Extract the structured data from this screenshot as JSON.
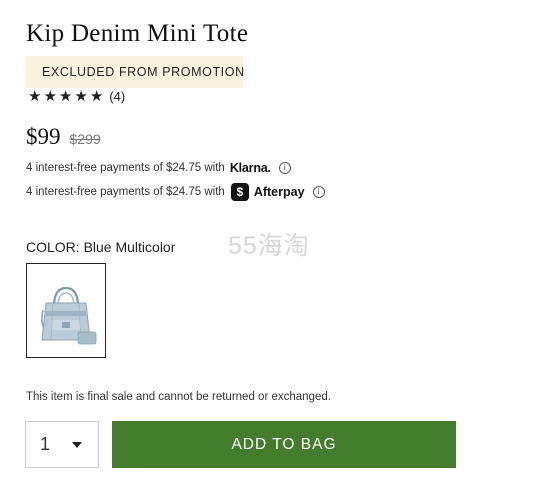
{
  "product": {
    "title": "Kip Denim Mini Tote",
    "promo_badge": "EXCLUDED FROM PROMOTION",
    "rating": {
      "stars": 5,
      "count_text": "(4)"
    },
    "price": {
      "sale": "$99",
      "original": "$299"
    }
  },
  "payments": {
    "klarna": {
      "text": "4 interest-free payments of $24.75 with",
      "brand": "Klarna."
    },
    "afterpay": {
      "text": "4 interest-free payments of $24.75 with",
      "brand": "Afterpay"
    }
  },
  "color": {
    "label": "COLOR: Blue Multicolor",
    "swatch_icon": "tote-bag-thumbnail"
  },
  "watermark": "55海淘",
  "final_sale_note": "This item is final sale and cannot be returned or exchanged.",
  "purchase": {
    "quantity": "1",
    "add_to_bag_label": "ADD TO BAG",
    "button_color": "#437c2b"
  },
  "colors": {
    "promo_badge_bg": "#fbf3df",
    "text_dark": "#111111"
  }
}
